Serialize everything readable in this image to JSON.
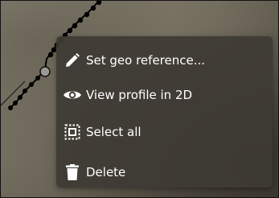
{
  "context_menu": {
    "items": [
      {
        "id": "set-geo-reference",
        "label": "Set geo reference...",
        "icon": "pencil-icon"
      },
      {
        "id": "view-profile-2d",
        "label": "View profile in 2D",
        "icon": "eye-icon"
      },
      {
        "id": "select-all",
        "label": "Select all",
        "icon": "select-all-icon"
      },
      {
        "id": "delete",
        "label": "Delete",
        "icon": "trash-icon"
      }
    ]
  },
  "colors": {
    "menu_background": "#3e3b34",
    "menu_text": "#ffffff",
    "polyline": "#000000",
    "vertex_handle": "#9a9a96"
  }
}
